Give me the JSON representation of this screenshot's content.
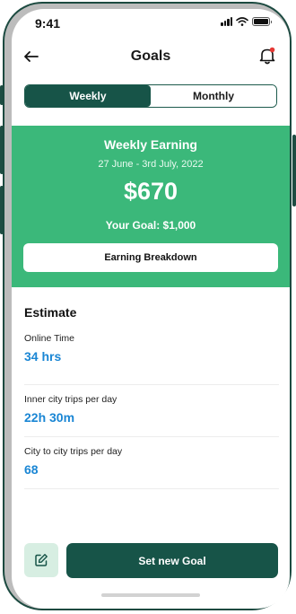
{
  "status_bar": {
    "time": "9:41",
    "icons": [
      "signal-icon",
      "wifi-icon",
      "battery-icon"
    ]
  },
  "header": {
    "title": "Goals",
    "back_icon": "arrow-left-icon",
    "bell_icon": "bell-icon",
    "notification_dot_color": "#e53935"
  },
  "tabs": [
    {
      "label": "Weekly",
      "active": true
    },
    {
      "label": "Monthly",
      "active": false
    }
  ],
  "earning": {
    "title": "Weekly Earning",
    "date_range": "27 June - 3rd July, 2022",
    "amount": "$670",
    "goal": "Your Goal: $1,000",
    "breakdown_label": "Earning Breakdown"
  },
  "estimate": {
    "title": "Estimate",
    "items": [
      {
        "label": "Online Time",
        "value": "34 hrs"
      },
      {
        "label": "Inner city trips per day",
        "value": "22h 30m"
      },
      {
        "label": "City to city trips per day",
        "value": "68"
      }
    ]
  },
  "footer": {
    "edit_icon": "edit-icon",
    "set_goal_label": "Set new Goal"
  },
  "colors": {
    "brand_dark": "#175448",
    "banner_green": "#3bb87a",
    "value_blue": "#1a86d4",
    "edit_bg": "#d7eee2"
  }
}
